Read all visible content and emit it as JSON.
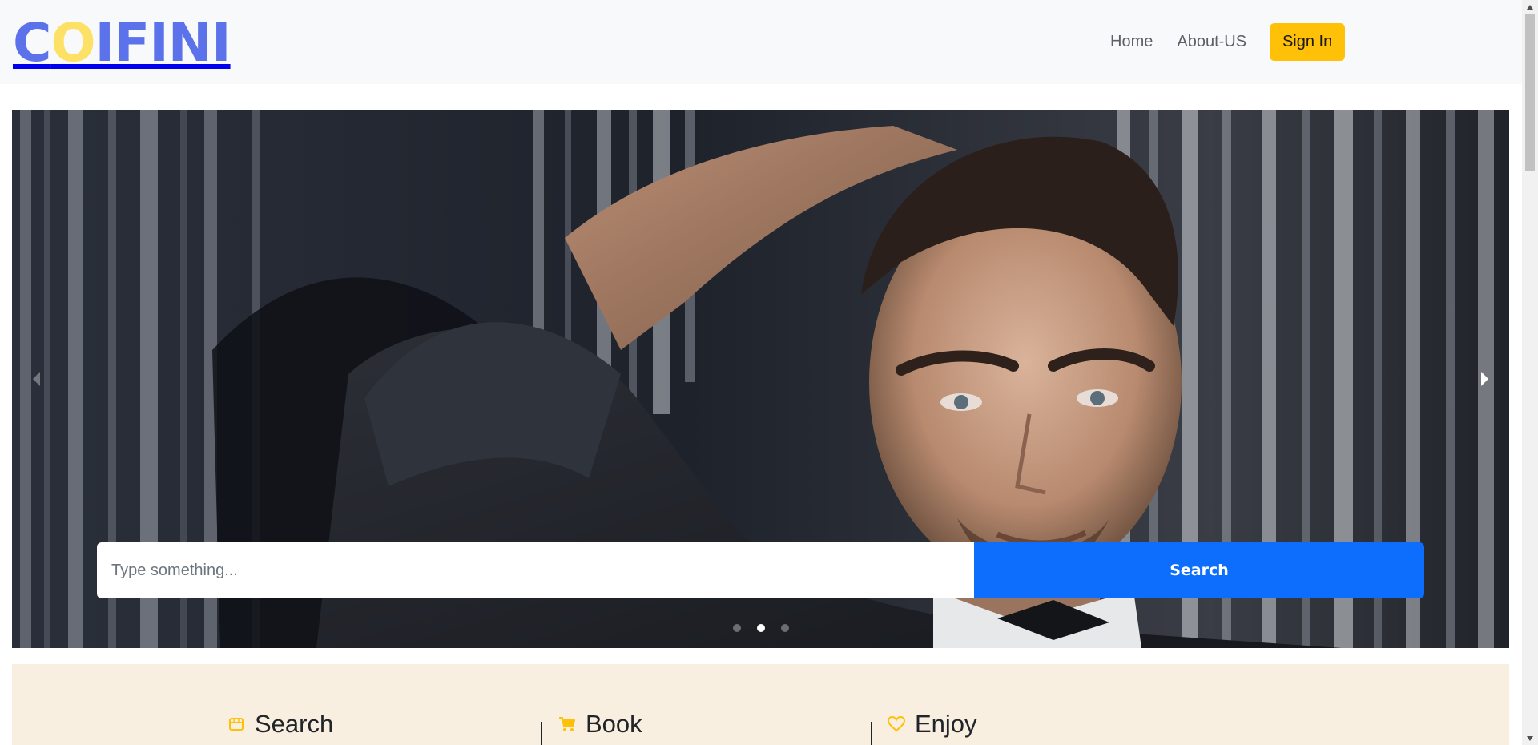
{
  "brand": {
    "logo_c": "C",
    "logo_o": "O",
    "logo_rest": "IFINI",
    "primary_color": "#5b72ea",
    "accent_color": "#fde166"
  },
  "nav": {
    "home": "Home",
    "about": "About-US",
    "signin": "Sign In",
    "signin_color": "#ffc107"
  },
  "hero": {
    "prev_icon": "chevron-left-icon",
    "next_icon": "chevron-right-icon",
    "search_placeholder": "Type something...",
    "search_button": "Search",
    "search_button_color": "#0d6efd",
    "slide_count": 3,
    "active_slide": 2
  },
  "features": [
    {
      "title": "Search",
      "icon": "shop-icon"
    },
    {
      "title": "Book",
      "icon": "cart-icon"
    },
    {
      "title": "Enjoy",
      "icon": "heart-icon"
    }
  ],
  "features_accent_color": "#ffc107",
  "features_background": "#f9efe1"
}
